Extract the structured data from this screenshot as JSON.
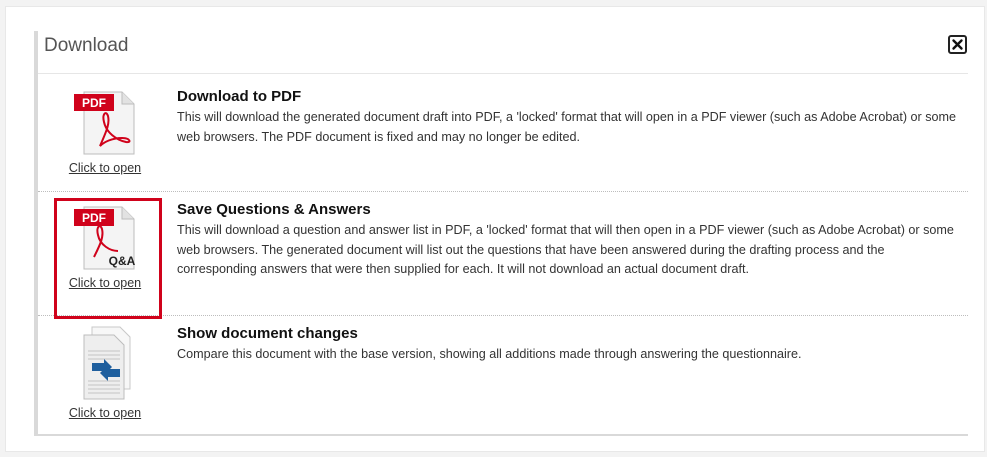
{
  "dialog": {
    "title": "Download",
    "close_icon": "close-x-icon"
  },
  "items": [
    {
      "icon": "pdf-document-icon",
      "badge": "PDF",
      "link": "Click to open",
      "title": "Download to PDF",
      "description": "This will download the generated document draft into PDF, a 'locked' format that will open in a PDF viewer (such as Adobe Acrobat) or some web browsers. The PDF document is fixed and may no longer be edited."
    },
    {
      "icon": "pdf-qa-document-icon",
      "badge": "PDF",
      "sub_badge": "Q&A",
      "link": "Click to open",
      "title": "Save Questions & Answers",
      "description": "This will download a question and answer list in PDF, a 'locked' format that will then open in a PDF viewer (such as Adobe Acrobat) or some web browsers. The generated document will list out the questions that have been answered during the drafting process and the corresponding answers that were then supplied for each. It will not download an actual document draft."
    },
    {
      "icon": "document-compare-icon",
      "link": "Click to open",
      "title": "Show document changes",
      "description": "Compare this document with the base version, showing all additions made through answering the questionnaire."
    }
  ],
  "colors": {
    "pdf_red": "#d0021b",
    "highlight": "#d0021b",
    "compare_blue": "#1f5f9e"
  }
}
